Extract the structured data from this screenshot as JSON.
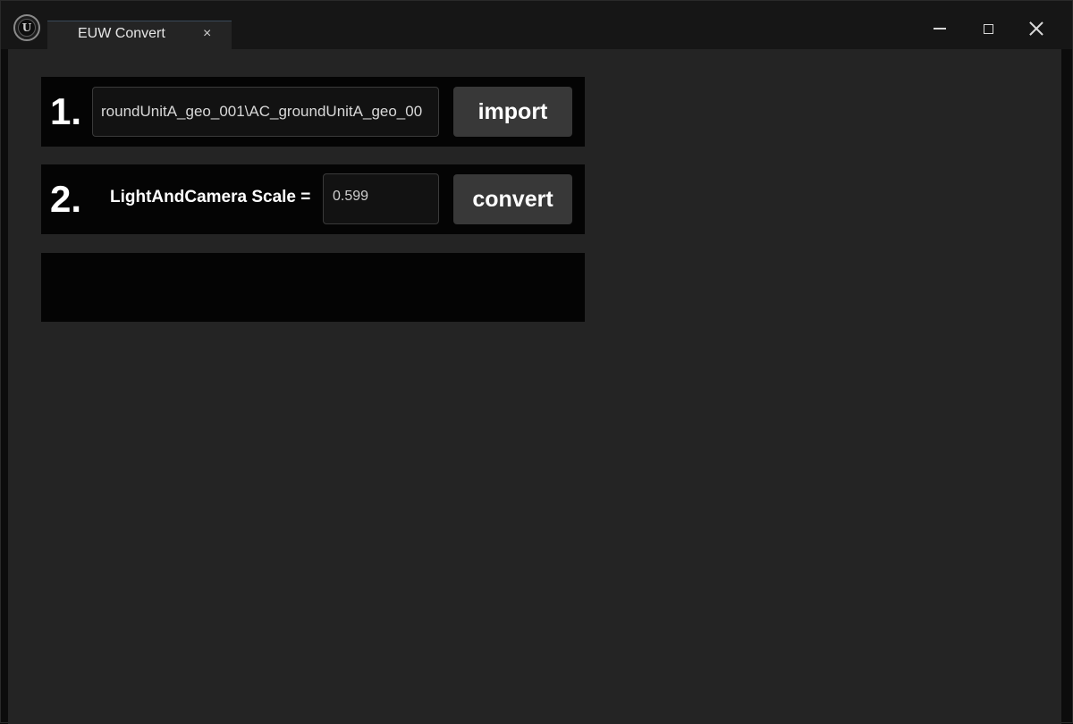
{
  "window": {
    "tab_title": "EUW Convert",
    "tab_close_symbol": "×",
    "logo_letter": "U"
  },
  "controls": {
    "minimize": "minimize-icon",
    "maximize": "maximize-icon",
    "close": "close-icon"
  },
  "step1": {
    "number": "1.",
    "path_value": "roundUnitA_geo_001\\AC_groundUnitA_geo_00",
    "import_label": "import"
  },
  "step2": {
    "number": "2.",
    "scale_label": "LightAndCamera Scale =",
    "scale_value": "0.599",
    "convert_label": "convert"
  },
  "colors": {
    "background": "#242424",
    "panel": "#040404",
    "button": "#383838",
    "titlebar": "#161616"
  }
}
